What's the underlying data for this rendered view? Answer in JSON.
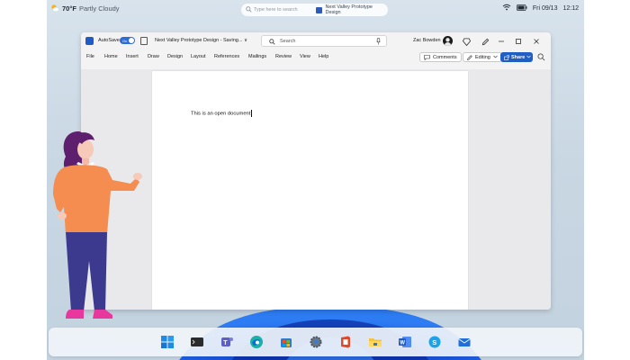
{
  "status_bar": {
    "temperature": "70°F",
    "condition": "Partly Cloudy",
    "search_placeholder": "Type here to search",
    "active_app": "Next Valley Prototype Design",
    "date": "Fri 09/13",
    "time": "12:12"
  },
  "word": {
    "autosave_label": "AutoSave",
    "autosave_state": "On",
    "document_title": "Next Valley Prototype Design - Saving... ∨",
    "search_label": "Search",
    "user_name": "Zac Bowden",
    "menu": [
      "File",
      "Home",
      "Insert",
      "Draw",
      "Design",
      "Layout",
      "References",
      "Mailings",
      "Review",
      "View",
      "Help"
    ],
    "comments_label": "Comments",
    "editing_label": "Editing",
    "share_label": "Share",
    "document_text": "This is an open document",
    "accent_color": "#1f5fc4"
  },
  "taskbar": {
    "apps": [
      "start-icon",
      "terminal-icon",
      "teams-icon",
      "edge-icon",
      "store-icon",
      "settings-icon",
      "office-icon",
      "file-explorer-icon",
      "word-icon",
      "skype-icon",
      "mail-icon"
    ]
  }
}
